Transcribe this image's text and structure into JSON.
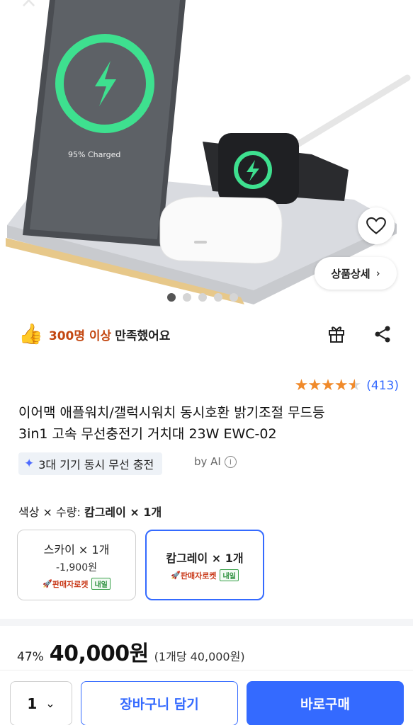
{
  "product_image": {
    "screen_text": "95% Charged",
    "detail_button": "상품상세",
    "active_dot": 0,
    "dot_count": 5,
    "icons": [
      "close-icon",
      "heart-icon",
      "chevron-right-icon"
    ]
  },
  "satisfaction": {
    "highlight": "300명 이상",
    "text": "만족했어요",
    "icons": [
      "thumbs-up-icon",
      "gift-icon",
      "share-icon"
    ]
  },
  "rating": {
    "stars": 4.5,
    "count": "(413)"
  },
  "title": {
    "line1": "이어맥 애플워치/갤럭시워치 동시호환 밝기조절 무드등",
    "line2": "3in1 고속 무선충전기 거치대 23W EWC-02"
  },
  "ai_summary": {
    "label": "3대 기기 동시 무선 충전",
    "by": "by AI"
  },
  "options": {
    "label_prefix": "색상 × 수량:",
    "label_value": "캄그레이 × 1개",
    "cards": [
      {
        "name": "스카이 × 1개",
        "price": "-1,900원",
        "rocket": "판매자로켓",
        "tag": "내일",
        "selected": false
      },
      {
        "name": "캄그레이 × 1개",
        "price": "",
        "rocket": "판매자로켓",
        "tag": "내일",
        "selected": true
      }
    ]
  },
  "price": {
    "discount": "47%",
    "value": "40,000원",
    "unit_price": "(1개당 40,000원)"
  },
  "actions": {
    "quantity": "1",
    "cart": "장바구니 담기",
    "buy": "바로구매"
  },
  "colors": {
    "accent": "#346aff",
    "star": "#f08a2b",
    "highlight": "#c34711",
    "charge_green": "#3ee08f"
  }
}
